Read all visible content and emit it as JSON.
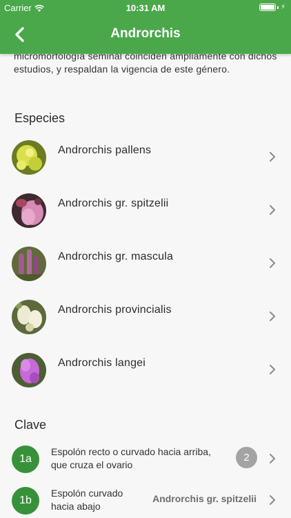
{
  "status": {
    "carrier": "Carrier",
    "time": "10:31 AM"
  },
  "nav": {
    "title": "Androrchis"
  },
  "intro_text": "micromorfología seminal coinciden ampliamente con dichos estudios, y respaldan la vigencia de este género.",
  "species_section": {
    "title": "Especies",
    "items": [
      {
        "name": "Androrchis pallens",
        "color": "#c8d43a"
      },
      {
        "name": "Androrchis gr. spitzelii",
        "color": "#c86c9c"
      },
      {
        "name": "Androrchis gr. mascula",
        "color": "#8a5a7a"
      },
      {
        "name": "Androrchis provincialis",
        "color": "#e6e4c4"
      },
      {
        "name": "Androrchis langei",
        "color": "#b257c8"
      }
    ]
  },
  "key_section": {
    "title": "Clave",
    "items": [
      {
        "badge": "1a",
        "line1": "Espolón recto o curvado hacia arriba,",
        "line2": "que cruza el ovario",
        "count": "2",
        "target": ""
      },
      {
        "badge": "1b",
        "line1": "Espolón curvado",
        "line2": "hacia abajo",
        "count": "",
        "target": "Androrchis gr. spitzelii"
      }
    ]
  },
  "colors": {
    "nav_green": "#4aa84b",
    "badge_green": "#37913a",
    "count_grey": "#a3a3a3"
  }
}
